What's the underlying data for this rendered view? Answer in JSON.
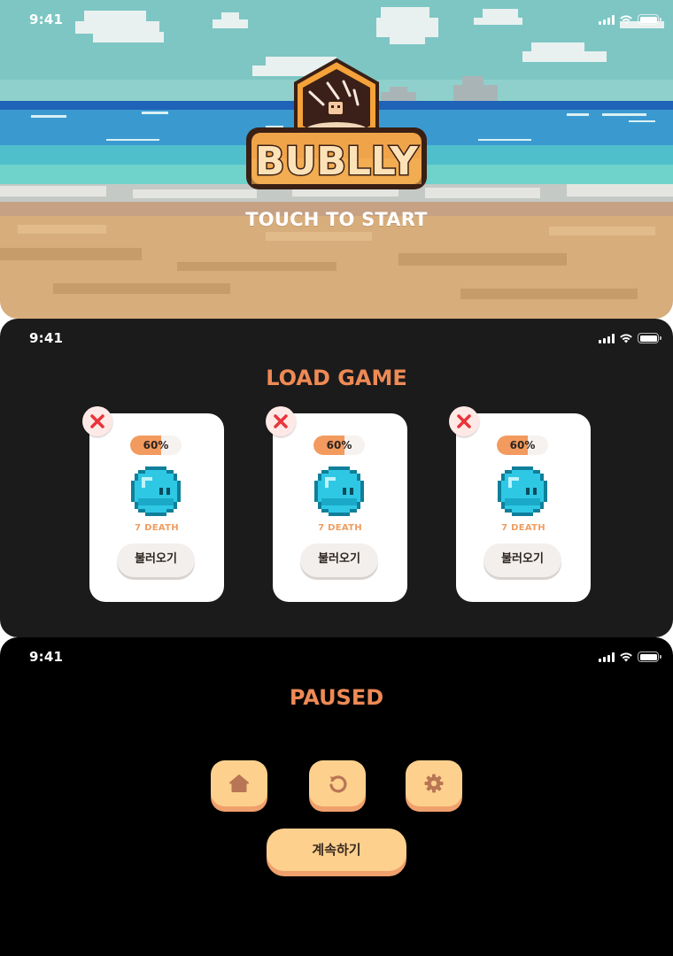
{
  "status_bar": {
    "time": "9:41"
  },
  "title_screen": {
    "logo_text": "BUBLLY",
    "start_prompt": "TOUCH TO START"
  },
  "load_screen": {
    "title": "LOAD GAME",
    "slots": [
      {
        "progress_label": "60%",
        "progress": 0.6,
        "deaths": "7 DEATH",
        "load_label": "불러오기"
      },
      {
        "progress_label": "60%",
        "progress": 0.6,
        "deaths": "7 DEATH",
        "load_label": "불러오기"
      },
      {
        "progress_label": "60%",
        "progress": 0.6,
        "deaths": "7 DEATH",
        "load_label": "불러오기"
      }
    ]
  },
  "pause_screen": {
    "title": "PAUSED",
    "icon_buttons": [
      "home-icon",
      "restart-icon",
      "gear-icon"
    ],
    "continue_label": "계속하기"
  },
  "colors": {
    "accent_orange": "#ee8a55",
    "progress_orange": "#f39a5e",
    "button_peach": "#fdd08e",
    "button_shadow": "#f0a06c",
    "delete_red": "#e8343a",
    "bubble_cyan": "#2ec8e4"
  }
}
